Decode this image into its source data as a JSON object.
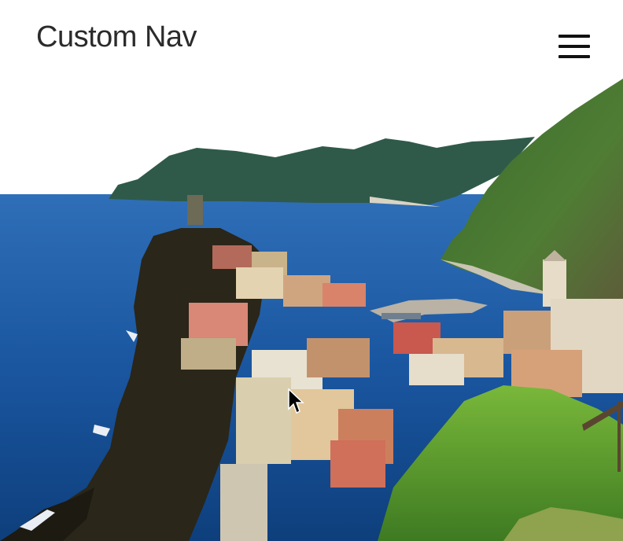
{
  "nav": {
    "brand": "Custom Nav",
    "menu_icon": "hamburger-menu-icon"
  },
  "hero": {
    "image_subject": "coastal-cliffside-village-photo"
  },
  "colors": {
    "brand_text": "#2b2b2b",
    "menu_icon": "#111111",
    "sea": "#1d5aa6",
    "sky": "#ffffff"
  }
}
